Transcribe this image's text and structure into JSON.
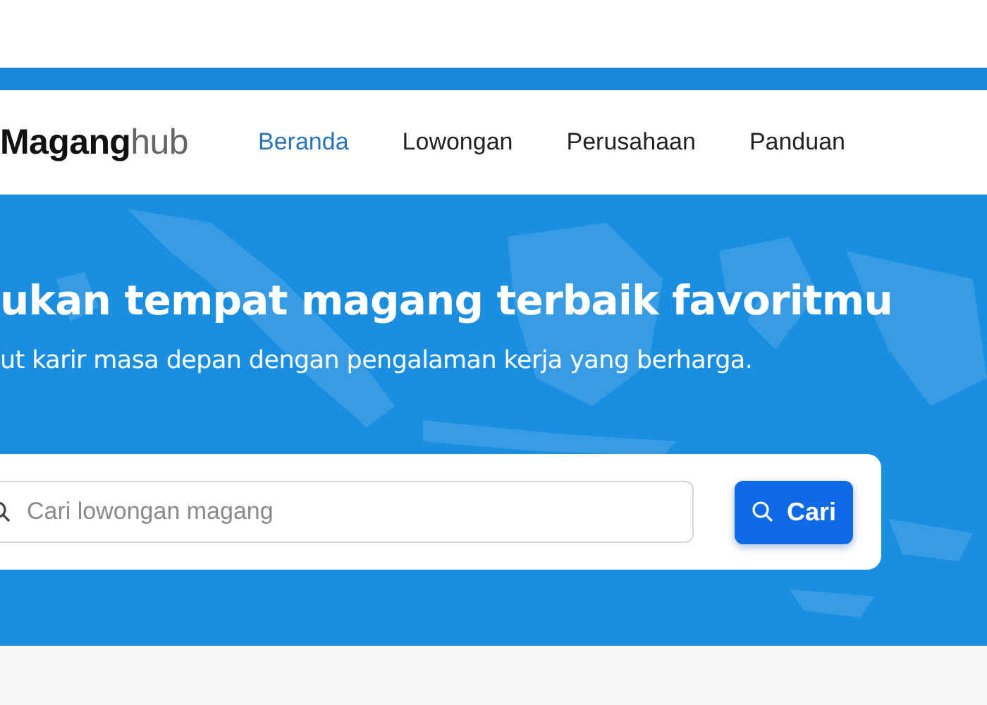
{
  "logo": {
    "bold": "Magang",
    "light": "hub"
  },
  "nav": [
    {
      "label": "Beranda",
      "selected": true
    },
    {
      "label": "Lowongan",
      "selected": false
    },
    {
      "label": "Perusahaan",
      "selected": false
    },
    {
      "label": "Panduan",
      "selected": false
    }
  ],
  "hero": {
    "title": "ukan tempat magang terbaik favoritmu",
    "subtitle": "ut karir masa depan dengan pengalaman kerja yang berharga."
  },
  "search": {
    "placeholder": "Cari lowongan magang",
    "button": "Cari"
  }
}
